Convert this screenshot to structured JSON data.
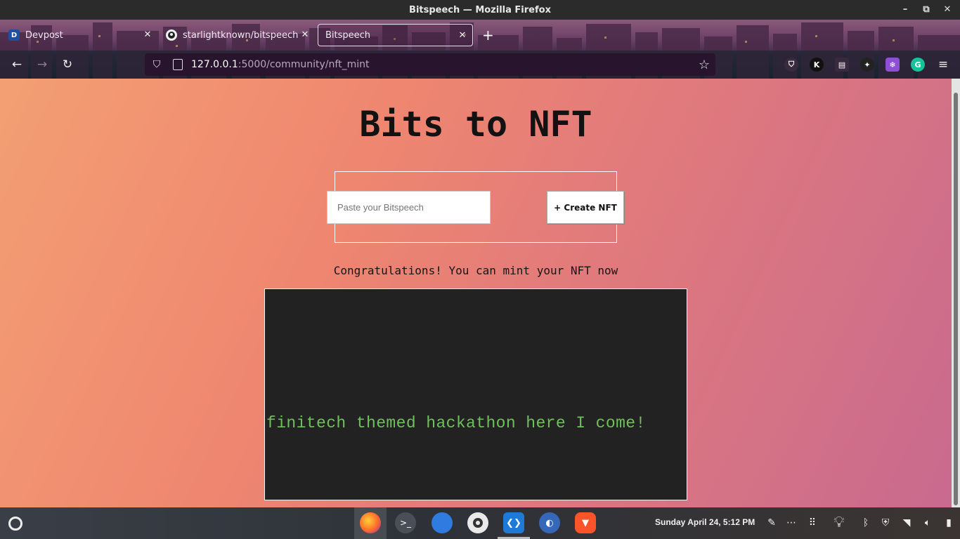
{
  "window": {
    "title": "Bitspeech — Mozilla Firefox",
    "minimize": "–",
    "maximize": "⧉",
    "close": "✕"
  },
  "tabs": [
    {
      "label": "Devpost",
      "favicon": "D",
      "icon": "devpost-icon"
    },
    {
      "label": "starlightknown/bitspeech",
      "icon": "github-icon"
    },
    {
      "label": "Bitspeech",
      "active": true
    }
  ],
  "navbar": {
    "url_host": "127.0.0.1",
    "url_path": ":5000/community/nft_mint"
  },
  "extensions": [
    {
      "name": "pocket-icon",
      "color": "#3a2a40"
    },
    {
      "name": "k-extension-icon",
      "label": "K",
      "color": "#111111"
    },
    {
      "name": "reader-icon",
      "color": "#3a2a40"
    },
    {
      "name": "dark-extension-icon",
      "color": "#222222"
    },
    {
      "name": "purple-extension-icon",
      "color": "#8e4fd6"
    },
    {
      "name": "grammarly-icon",
      "label": "G",
      "color": "#15c39a"
    }
  ],
  "page": {
    "title": "Bits to NFT",
    "input_placeholder": "Paste your Bitspeech",
    "create_button": "+ Create NFT",
    "message": "Congratulations! You can mint your NFT now",
    "nft_text": "finitech themed hackathon here I come!"
  },
  "colors": {
    "gradient_start": "#f39f73",
    "gradient_end": "#c96a8f",
    "nft_background": "#222222",
    "nft_text": "#6fbf5c"
  },
  "taskbar": {
    "clock": "Sunday April 24,  5:12 PM",
    "apps": [
      "firefox-icon",
      "terminal-icon",
      "files-icon",
      "obs-icon",
      "vscode-icon",
      "toggle-app-icon",
      "brave-icon"
    ]
  }
}
